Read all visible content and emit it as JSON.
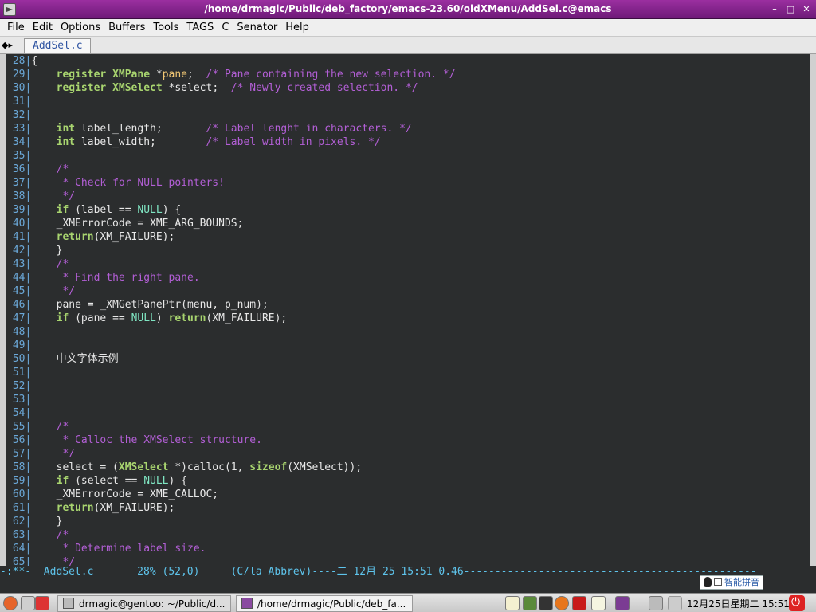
{
  "window": {
    "title": "/home/drmagic/Public/deb_factory/emacs-23.60/oldXMenu/AddSel.c@emacs",
    "buttons": [
      "–",
      "□",
      "✕"
    ]
  },
  "menu": [
    "File",
    "Edit",
    "Options",
    "Buffers",
    "Tools",
    "TAGS",
    "C",
    "Senator",
    "Help"
  ],
  "tab": {
    "label": "AddSel.c"
  },
  "code_lines": [
    {
      "n": "28",
      "segs": [
        [
          "t",
          "{"
        ]
      ]
    },
    {
      "n": "29",
      "segs": [
        [
          "t",
          "    "
        ],
        [
          "kw",
          "register"
        ],
        [
          "t",
          " "
        ],
        [
          "ty",
          "XMPane"
        ],
        [
          "t",
          " *"
        ],
        [
          "vr",
          "pane"
        ],
        [
          "t",
          ";  "
        ],
        [
          "cm",
          "/* Pane containing the new selection. */"
        ]
      ]
    },
    {
      "n": "30",
      "segs": [
        [
          "t",
          "    "
        ],
        [
          "kw",
          "register"
        ],
        [
          "t",
          " "
        ],
        [
          "ty",
          "XMSelect"
        ],
        [
          "t",
          " *select;  "
        ],
        [
          "cm",
          "/* Newly created selection. */"
        ]
      ]
    },
    {
      "n": "31",
      "segs": []
    },
    {
      "n": "32",
      "segs": []
    },
    {
      "n": "33",
      "segs": [
        [
          "t",
          "    "
        ],
        [
          "kw",
          "int"
        ],
        [
          "t",
          " label_length;       "
        ],
        [
          "cm",
          "/* Label lenght in characters. */"
        ]
      ]
    },
    {
      "n": "34",
      "segs": [
        [
          "t",
          "    "
        ],
        [
          "kw",
          "int"
        ],
        [
          "t",
          " label_width;        "
        ],
        [
          "cm",
          "/* Label width in pixels. */"
        ]
      ]
    },
    {
      "n": "35",
      "segs": []
    },
    {
      "n": "36",
      "segs": [
        [
          "t",
          "    "
        ],
        [
          "cm",
          "/*"
        ]
      ]
    },
    {
      "n": "37",
      "segs": [
        [
          "t",
          "     "
        ],
        [
          "cm",
          "* Check for NULL pointers!"
        ]
      ]
    },
    {
      "n": "38",
      "segs": [
        [
          "t",
          "     "
        ],
        [
          "cm",
          "*/"
        ]
      ]
    },
    {
      "n": "39",
      "segs": [
        [
          "t",
          "    "
        ],
        [
          "kw",
          "if"
        ],
        [
          "t",
          " (label == "
        ],
        [
          "cn",
          "NULL"
        ],
        [
          "t",
          ") {"
        ]
      ]
    },
    {
      "n": "40",
      "segs": [
        [
          "t",
          "    _XMErrorCode = XME_ARG_BOUNDS;"
        ]
      ]
    },
    {
      "n": "41",
      "segs": [
        [
          "t",
          "    "
        ],
        [
          "kw",
          "return"
        ],
        [
          "t",
          "(XM_FAILURE);"
        ]
      ]
    },
    {
      "n": "42",
      "segs": [
        [
          "t",
          "    }"
        ]
      ]
    },
    {
      "n": "43",
      "segs": [
        [
          "t",
          "    "
        ],
        [
          "cm",
          "/*"
        ]
      ]
    },
    {
      "n": "44",
      "segs": [
        [
          "t",
          "     "
        ],
        [
          "cm",
          "* Find the right pane."
        ]
      ]
    },
    {
      "n": "45",
      "segs": [
        [
          "t",
          "     "
        ],
        [
          "cm",
          "*/"
        ]
      ]
    },
    {
      "n": "46",
      "segs": [
        [
          "t",
          "    pane = _XMGetPanePtr(menu, p_num);"
        ]
      ]
    },
    {
      "n": "47",
      "segs": [
        [
          "t",
          "    "
        ],
        [
          "kw",
          "if"
        ],
        [
          "t",
          " (pane == "
        ],
        [
          "cn",
          "NULL"
        ],
        [
          "t",
          ") "
        ],
        [
          "kw",
          "return"
        ],
        [
          "t",
          "(XM_FAILURE);"
        ]
      ]
    },
    {
      "n": "48",
      "segs": []
    },
    {
      "n": "49",
      "segs": []
    },
    {
      "n": "50",
      "segs": [
        [
          "t",
          "    中文字体示例"
        ]
      ]
    },
    {
      "n": "51",
      "segs": []
    },
    {
      "n": "52",
      "segs": []
    },
    {
      "n": "53",
      "segs": []
    },
    {
      "n": "54",
      "segs": []
    },
    {
      "n": "55",
      "segs": [
        [
          "t",
          "    "
        ],
        [
          "cm",
          "/*"
        ]
      ]
    },
    {
      "n": "56",
      "segs": [
        [
          "t",
          "     "
        ],
        [
          "cm",
          "* Calloc the XMSelect structure."
        ]
      ]
    },
    {
      "n": "57",
      "segs": [
        [
          "t",
          "     "
        ],
        [
          "cm",
          "*/"
        ]
      ]
    },
    {
      "n": "58",
      "segs": [
        [
          "t",
          "    select = ("
        ],
        [
          "ty",
          "XMSelect"
        ],
        [
          "t",
          " *)calloc(1, "
        ],
        [
          "kw",
          "sizeof"
        ],
        [
          "t",
          "(XMSelect));"
        ]
      ]
    },
    {
      "n": "59",
      "segs": [
        [
          "t",
          "    "
        ],
        [
          "kw",
          "if"
        ],
        [
          "t",
          " (select == "
        ],
        [
          "cn",
          "NULL"
        ],
        [
          "t",
          ") {"
        ]
      ]
    },
    {
      "n": "60",
      "segs": [
        [
          "t",
          "    _XMErrorCode = XME_CALLOC;"
        ]
      ]
    },
    {
      "n": "61",
      "segs": [
        [
          "t",
          "    "
        ],
        [
          "kw",
          "return"
        ],
        [
          "t",
          "(XM_FAILURE);"
        ]
      ]
    },
    {
      "n": "62",
      "segs": [
        [
          "t",
          "    }"
        ]
      ]
    },
    {
      "n": "63",
      "segs": [
        [
          "t",
          "    "
        ],
        [
          "cm",
          "/*"
        ]
      ]
    },
    {
      "n": "64",
      "segs": [
        [
          "t",
          "     "
        ],
        [
          "cm",
          "* Determine label size."
        ]
      ]
    },
    {
      "n": "65",
      "segs": [
        [
          "t",
          "     "
        ],
        [
          "cm",
          "*/"
        ]
      ]
    }
  ],
  "modeline": "-:**-  AddSel.c       28% (52,0)     (C/la Abbrev)----二 12月 25 15:51 0.46-----------------------------------------------",
  "ime": {
    "label": "智能拼音"
  },
  "taskbar": {
    "tasks": [
      {
        "label": "drmagic@gentoo: ~/Public/d..."
      },
      {
        "label": "/home/drmagic/Public/deb_fa..."
      }
    ],
    "clock": "12月25日星期二 15:51"
  }
}
